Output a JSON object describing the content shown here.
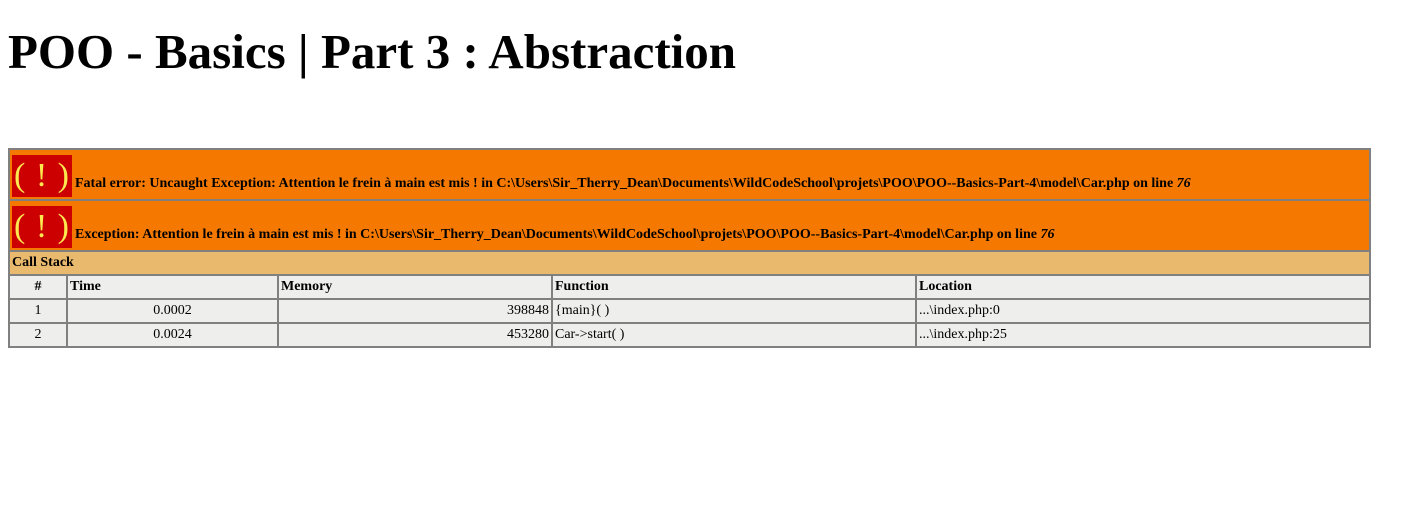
{
  "page": {
    "title": "POO - Basics | Part 3 : Abstraction"
  },
  "errors": [
    {
      "icon": "( ! )",
      "message": "Fatal error: Uncaught Exception: Attention le frein à main est mis ! in C:\\Users\\Sir_Therry_Dean\\Documents\\WildCodeSchool\\projets\\POO\\POO--Basics-Part-4\\model\\Car.php on line ",
      "line": "76"
    },
    {
      "icon": "( ! )",
      "message": "Exception: Attention le frein à main est mis ! in C:\\Users\\Sir_Therry_Dean\\Documents\\WildCodeSchool\\projets\\POO\\POO--Basics-Part-4\\model\\Car.php on line ",
      "line": "76"
    }
  ],
  "call_stack": {
    "title": "Call Stack",
    "columns": [
      "#",
      "Time",
      "Memory",
      "Function",
      "Location"
    ],
    "rows": [
      {
        "num": "1",
        "time": "0.0002",
        "memory": "398848",
        "function": "{main}( )",
        "location": "...\\index.php:0"
      },
      {
        "num": "2",
        "time": "0.0024",
        "memory": "453280",
        "function": "Car->start( )",
        "location": "...\\index.php:25"
      }
    ]
  },
  "colors": {
    "error_bg": "#f57900",
    "icon_bg": "#cc0000",
    "icon_fg": "#fce94f",
    "callstack_bg": "#e9b96e",
    "row_bg": "#eeeeec"
  }
}
